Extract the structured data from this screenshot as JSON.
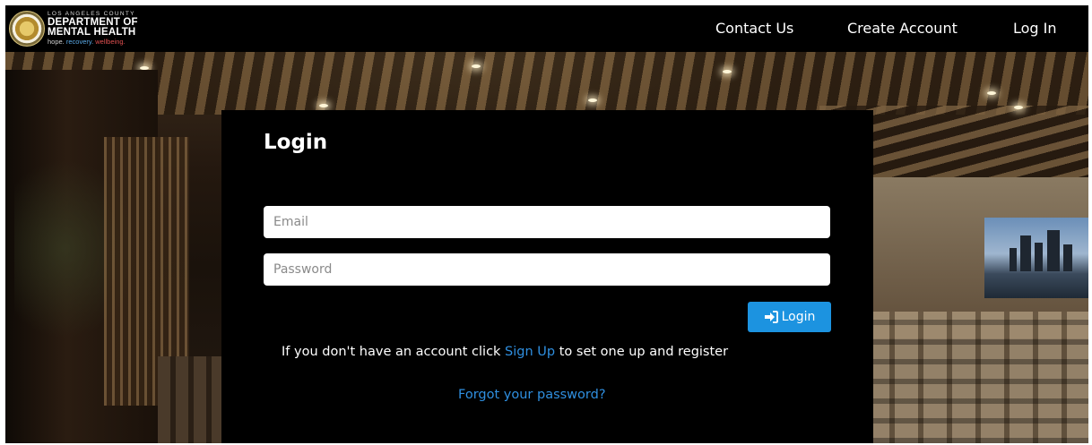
{
  "header": {
    "logo": {
      "top_line": "LOS ANGELES COUNTY",
      "line1": "DEPARTMENT OF",
      "line2": "MENTAL HEALTH",
      "tagline_a": "hope.",
      "tagline_b": "recovery.",
      "tagline_c": "wellbeing."
    },
    "nav": {
      "contact": "Contact Us",
      "create": "Create Account",
      "login": "Log In"
    }
  },
  "login": {
    "title": "Login",
    "email_placeholder": "Email",
    "password_placeholder": "Password",
    "button_label": "Login",
    "signup_prefix": "If you don't have an account click ",
    "signup_link": "Sign Up",
    "signup_suffix": " to set one up and register",
    "forgot": "Forgot your password?"
  },
  "colors": {
    "accent": "#1c93e0",
    "link": "#2f8fe0",
    "card": "#000000"
  },
  "icons": {
    "login_button": "sign-in-icon",
    "logo": "county-seal-icon"
  }
}
